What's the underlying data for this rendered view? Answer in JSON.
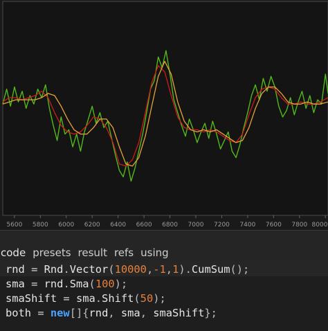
{
  "chart_data": {
    "type": "line",
    "x_ticks": [
      5600,
      5800,
      6000,
      6200,
      6400,
      6600,
      6800,
      7000,
      7200,
      7400,
      7600,
      7800,
      8000
    ],
    "x_tick_labels": [
      "5600",
      "5800",
      "6000",
      "6200",
      "6400",
      "6600",
      "6800",
      "7000",
      "7200",
      "7400",
      "7600",
      "7800",
      "8000"
    ],
    "xlim": [
      5510,
      8020
    ],
    "ylim": [
      0,
      10
    ],
    "series": [
      {
        "color": "#52b81c",
        "x": [
          5510,
          5540,
          5570,
          5600,
          5630,
          5660,
          5690,
          5720,
          5750,
          5780,
          5810,
          5840,
          5870,
          5900,
          5930,
          5960,
          5990,
          6020,
          6050,
          6080,
          6110,
          6140,
          6170,
          6200,
          6230,
          6260,
          6290,
          6320,
          6350,
          6380,
          6410,
          6440,
          6470,
          6500,
          6530,
          6560,
          6590,
          6620,
          6650,
          6680,
          6710,
          6740,
          6770,
          6800,
          6830,
          6860,
          6890,
          6920,
          6950,
          6980,
          7010,
          7040,
          7070,
          7100,
          7130,
          7160,
          7190,
          7220,
          7250,
          7280,
          7310,
          7340,
          7370,
          7400,
          7430,
          7460,
          7490,
          7520,
          7550,
          7580,
          7610,
          7640,
          7670,
          7700,
          7730,
          7760,
          7790,
          7820,
          7850,
          7880,
          7910,
          7940,
          7970,
          8000,
          8020
        ],
        "y": [
          5.2,
          5.9,
          5.1,
          6.0,
          5.3,
          5.8,
          5.0,
          5.6,
          5.2,
          5.9,
          5.5,
          6.1,
          5.0,
          4.2,
          3.5,
          4.6,
          3.8,
          4.0,
          3.2,
          3.8,
          3.0,
          3.9,
          4.5,
          5.1,
          4.3,
          4.8,
          4.1,
          4.4,
          3.6,
          2.8,
          2.1,
          1.8,
          2.5,
          1.6,
          2.2,
          3.0,
          3.8,
          4.8,
          5.9,
          6.3,
          7.4,
          6.9,
          7.7,
          6.6,
          5.4,
          4.8,
          4.2,
          3.7,
          4.5,
          4.0,
          3.4,
          3.9,
          4.3,
          3.6,
          4.4,
          3.8,
          3.1,
          3.5,
          3.9,
          3.0,
          2.7,
          3.3,
          4.1,
          4.8,
          5.6,
          6.1,
          5.4,
          6.4,
          5.8,
          6.5,
          6.0,
          5.1,
          4.6,
          4.9,
          5.5,
          4.7,
          5.3,
          5.8,
          5.0,
          5.6,
          4.8,
          5.4,
          5.2,
          6.6,
          5.7
        ]
      },
      {
        "color": "#d21a1a",
        "x": [
          5510,
          5560,
          5610,
          5660,
          5710,
          5760,
          5810,
          5860,
          5910,
          5960,
          6010,
          6060,
          6110,
          6160,
          6210,
          6260,
          6310,
          6360,
          6410,
          6460,
          6510,
          6560,
          6610,
          6660,
          6710,
          6760,
          6810,
          6860,
          6910,
          6960,
          7010,
          7060,
          7110,
          7160,
          7210,
          7260,
          7310,
          7360,
          7410,
          7460,
          7510,
          7560,
          7610,
          7660,
          7710,
          7760,
          7810,
          7860,
          7910,
          7960,
          8020
        ],
        "y": [
          5.3,
          5.5,
          5.5,
          5.4,
          5.5,
          5.6,
          5.8,
          5.5,
          4.8,
          4.2,
          3.9,
          3.8,
          3.9,
          4.2,
          4.6,
          4.5,
          4.1,
          3.4,
          2.4,
          2.3,
          2.6,
          3.4,
          4.8,
          6.2,
          7.0,
          6.7,
          5.6,
          4.6,
          4.1,
          4.0,
          4.0,
          3.9,
          4.0,
          3.9,
          3.7,
          3.5,
          3.4,
          3.8,
          4.7,
          5.5,
          5.9,
          6.0,
          5.9,
          5.5,
          5.2,
          5.2,
          5.3,
          5.2,
          5.2,
          5.3,
          5.5
        ]
      },
      {
        "color": "#e8a23a",
        "x": [
          5510,
          5560,
          5610,
          5660,
          5710,
          5760,
          5810,
          5860,
          5910,
          5960,
          6010,
          6060,
          6110,
          6160,
          6210,
          6260,
          6310,
          6360,
          6410,
          6460,
          6510,
          6560,
          6610,
          6660,
          6710,
          6760,
          6810,
          6860,
          6910,
          6960,
          7010,
          7060,
          7110,
          7160,
          7210,
          7260,
          7310,
          7360,
          7410,
          7460,
          7510,
          7560,
          7610,
          7660,
          7710,
          7760,
          7810,
          7860,
          7910,
          7960,
          8020
        ],
        "y": [
          5.2,
          5.3,
          5.4,
          5.4,
          5.4,
          5.4,
          5.5,
          5.7,
          5.6,
          5.1,
          4.5,
          4.0,
          3.8,
          3.8,
          4.1,
          4.5,
          4.5,
          4.1,
          3.2,
          2.4,
          2.3,
          2.7,
          3.7,
          5.1,
          6.5,
          7.2,
          6.6,
          5.3,
          4.4,
          4.0,
          3.9,
          4.0,
          3.9,
          4.0,
          3.8,
          3.6,
          3.4,
          3.5,
          4.1,
          5.0,
          5.7,
          6.0,
          6.0,
          5.7,
          5.3,
          5.2,
          5.2,
          5.3,
          5.2,
          5.2,
          5.3
        ]
      }
    ]
  },
  "tabs": [
    {
      "label": "code",
      "active": true
    },
    {
      "label": "presets",
      "active": false
    },
    {
      "label": "result",
      "active": false
    },
    {
      "label": "refs",
      "active": false
    },
    {
      "label": "using",
      "active": false
    }
  ],
  "code": [
    [
      [
        "rnd",
        "id"
      ],
      [
        " = ",
        "op"
      ],
      [
        "Rnd",
        "id"
      ],
      [
        ".",
        "pun"
      ],
      [
        "Vector",
        "id"
      ],
      [
        "(",
        "pun"
      ],
      [
        "10000",
        "num"
      ],
      [
        ",",
        "pun"
      ],
      [
        "-1",
        "num"
      ],
      [
        ",",
        "pun"
      ],
      [
        "1",
        "num"
      ],
      [
        ")",
        "pun"
      ],
      [
        ".",
        "pun"
      ],
      [
        "CumSum",
        "id"
      ],
      [
        "();",
        "pun"
      ]
    ],
    [
      [
        "sma",
        "id"
      ],
      [
        " = ",
        "op"
      ],
      [
        "rnd",
        "id"
      ],
      [
        ".",
        "pun"
      ],
      [
        "Sma",
        "id"
      ],
      [
        "(",
        "pun"
      ],
      [
        "100",
        "num"
      ],
      [
        ");",
        "pun"
      ]
    ],
    [
      [
        "smaShift",
        "id"
      ],
      [
        " = ",
        "op"
      ],
      [
        "sma",
        "id"
      ],
      [
        ".",
        "pun"
      ],
      [
        "Shift",
        "id"
      ],
      [
        "(",
        "pun"
      ],
      [
        "50",
        "num"
      ],
      [
        ");",
        "pun"
      ]
    ],
    [
      [
        "both",
        "id"
      ],
      [
        " = ",
        "op"
      ],
      [
        "new",
        "kw"
      ],
      [
        "[]",
        "pun"
      ],
      [
        "{",
        "pun"
      ],
      [
        "rnd",
        "id"
      ],
      [
        ", ",
        "pun"
      ],
      [
        "sma",
        "id"
      ],
      [
        ", ",
        "pun"
      ],
      [
        "smaShift",
        "id"
      ],
      [
        "};",
        "pun"
      ]
    ]
  ]
}
